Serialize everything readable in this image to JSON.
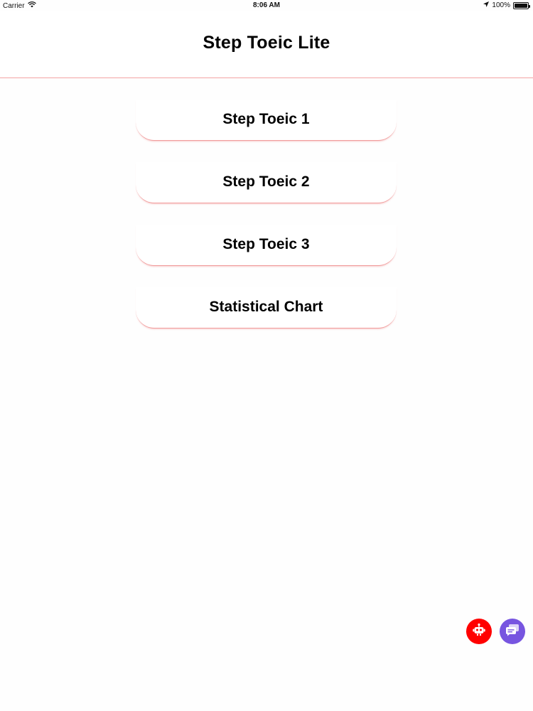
{
  "status_bar": {
    "carrier": "Carrier",
    "time": "8:06 AM",
    "battery": "100%",
    "battery_level": 1.0,
    "icons": [
      "wifi-icon",
      "location-arrow-icon",
      "battery-icon"
    ]
  },
  "nav": {
    "title": "Step Toeic Lite"
  },
  "menu": {
    "items": [
      {
        "label": "Step Toeic 1"
      },
      {
        "label": "Step Toeic 2"
      },
      {
        "label": "Step Toeic 3"
      },
      {
        "label": "Statistical Chart"
      }
    ]
  },
  "floating_buttons": {
    "robot": {
      "icon": "robot-icon",
      "color": "#ff0000"
    },
    "chat": {
      "icon": "chat-icon",
      "color": "#7755e0"
    }
  },
  "colors": {
    "accent_line": "#f3a3a3",
    "background": "#fefefe"
  }
}
